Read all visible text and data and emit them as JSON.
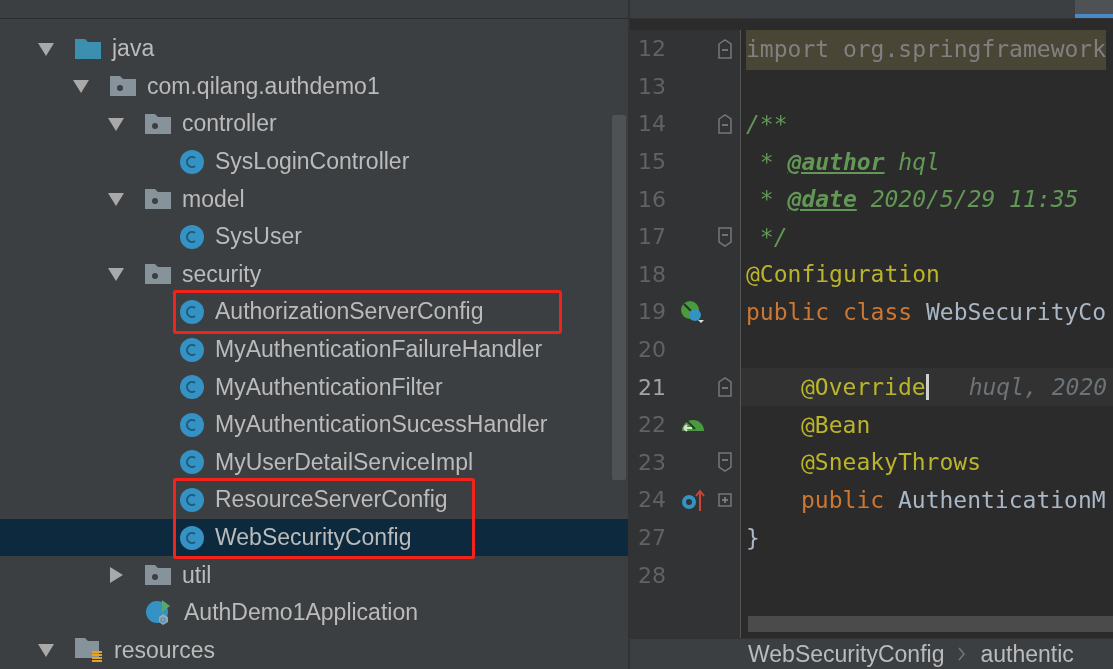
{
  "project_tree": {
    "items": [
      {
        "label": "java",
        "kind": "source-folder",
        "expanded": true,
        "selected": false,
        "children": [
          {
            "label": "com.qilang.authdemo1",
            "kind": "package",
            "expanded": true,
            "selected": false,
            "children": [
              {
                "label": "controller",
                "kind": "package",
                "expanded": true,
                "selected": false,
                "children": [
                  {
                    "label": "SysLoginController",
                    "kind": "class",
                    "selected": false
                  }
                ]
              },
              {
                "label": "model",
                "kind": "package",
                "expanded": true,
                "selected": false,
                "children": [
                  {
                    "label": "SysUser",
                    "kind": "class",
                    "selected": false
                  }
                ]
              },
              {
                "label": "security",
                "kind": "package",
                "expanded": true,
                "selected": false,
                "children": [
                  {
                    "label": "AuthorizationServerConfig",
                    "kind": "class",
                    "selected": false,
                    "highlighted": true
                  },
                  {
                    "label": "MyAuthenticationFailureHandler",
                    "kind": "class",
                    "selected": false
                  },
                  {
                    "label": "MyAuthenticationFilter",
                    "kind": "class",
                    "selected": false
                  },
                  {
                    "label": "MyAuthenticationSucessHandler",
                    "kind": "class",
                    "selected": false
                  },
                  {
                    "label": "MyUserDetailServiceImpl",
                    "kind": "class",
                    "selected": false
                  },
                  {
                    "label": "ResourceServerConfig",
                    "kind": "class",
                    "selected": false,
                    "highlighted": true
                  },
                  {
                    "label": "WebSecurityConfig",
                    "kind": "class",
                    "selected": true,
                    "highlighted": true
                  }
                ]
              },
              {
                "label": "util",
                "kind": "package",
                "expanded": false,
                "selected": false
              },
              {
                "label": "AuthDemo1Application",
                "kind": "spring-app",
                "selected": false
              }
            ]
          }
        ]
      },
      {
        "label": "resources",
        "kind": "resources-folder",
        "expanded": true,
        "selected": false
      }
    ]
  },
  "editor": {
    "lines": [
      {
        "number": "12",
        "current": false,
        "gutter": [
          {
            "kind": "fold-start"
          }
        ],
        "tokens": [
          {
            "kind": "folded",
            "text": "import org.springframework"
          }
        ]
      },
      {
        "number": "13",
        "current": false
      },
      {
        "number": "14",
        "current": false,
        "gutter": [
          {
            "kind": "fold-start"
          }
        ],
        "tokens": [
          {
            "kind": "comment",
            "text": "/**"
          }
        ]
      },
      {
        "number": "15",
        "current": false,
        "tokens": [
          {
            "kind": "comment",
            "text": " * "
          },
          {
            "kind": "doctag",
            "text": "@author"
          },
          {
            "kind": "comment",
            "text": " hql"
          }
        ]
      },
      {
        "number": "16",
        "current": false,
        "tokens": [
          {
            "kind": "comment",
            "text": " * "
          },
          {
            "kind": "doctag",
            "text": "@date"
          },
          {
            "kind": "comment",
            "text": " 2020/5/29 11:35"
          }
        ]
      },
      {
        "number": "17",
        "current": false,
        "gutter": [
          {
            "kind": "fold-end"
          }
        ],
        "tokens": [
          {
            "kind": "comment",
            "text": " */"
          }
        ]
      },
      {
        "number": "18",
        "current": false,
        "tokens": [
          {
            "kind": "annotation",
            "text": "@Configuration"
          }
        ]
      },
      {
        "number": "19",
        "current": false,
        "gutter": [
          {
            "kind": "spring-class"
          }
        ],
        "tokens": [
          {
            "kind": "keyword",
            "text": "public class "
          },
          {
            "kind": "plain",
            "text": "WebSecurityCo"
          }
        ]
      },
      {
        "number": "20",
        "current": false
      },
      {
        "number": "21",
        "current": true,
        "indented": true,
        "gutter": [
          {
            "kind": "fold-start"
          }
        ],
        "tokens": [
          {
            "kind": "annotation",
            "text": "@Override"
          },
          {
            "kind": "blame",
            "text": "huql, 2020"
          }
        ]
      },
      {
        "number": "22",
        "current": false,
        "indented": true,
        "gutter": [
          {
            "kind": "bean"
          }
        ],
        "tokens": [
          {
            "kind": "annotation",
            "text": "@Bean"
          }
        ]
      },
      {
        "number": "23",
        "current": false,
        "indented": true,
        "gutter": [
          {
            "kind": "fold-end"
          }
        ],
        "tokens": [
          {
            "kind": "annotation",
            "text": "@SneakyThrows"
          }
        ]
      },
      {
        "number": "24",
        "current": false,
        "indented": true,
        "gutter": [
          {
            "kind": "override"
          },
          {
            "kind": "fold-collapsed"
          }
        ],
        "tokens": [
          {
            "kind": "keyword",
            "text": "public "
          },
          {
            "kind": "plain",
            "text": "AuthenticationM"
          }
        ]
      },
      {
        "number": "27",
        "current": false,
        "tokens": [
          {
            "kind": "plain",
            "text": "}"
          }
        ]
      },
      {
        "number": "28",
        "current": false
      }
    ]
  },
  "breadcrumbs": [
    "WebSecurityConfig",
    "authentic"
  ]
}
